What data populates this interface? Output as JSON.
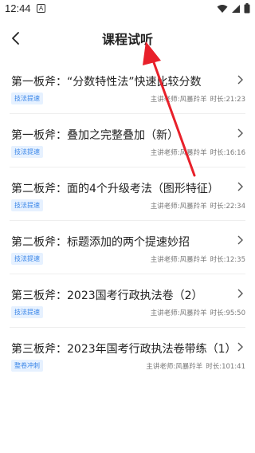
{
  "status_bar": {
    "time": "12:44",
    "notification_glyph": "A",
    "icons": [
      "wifi-icon",
      "signal-icon",
      "battery-icon"
    ]
  },
  "header": {
    "title": "课程试听",
    "back_icon": "chevron-left-icon"
  },
  "courses": [
    {
      "title": "第一板斧：“分数特性法”快速比较分数",
      "tag": "技法提速",
      "teacher": "主讲老师:风暴羚羊",
      "duration": "时长:21:23"
    },
    {
      "title": "第一板斧：叠加之完整叠加（新）",
      "tag": "技法提速",
      "teacher": "主讲老师:风暴羚羊",
      "duration": "时长:16:16"
    },
    {
      "title": "第二板斧：面的4个升级考法（图形特征）",
      "tag": "技法提速",
      "teacher": "主讲老师:风暴羚羊",
      "duration": "时长:22:34"
    },
    {
      "title": "第二板斧：标题添加的两个提速妙招",
      "tag": "技法提速",
      "teacher": "主讲老师:风暴羚羊",
      "duration": "时长:12:35"
    },
    {
      "title": "第三板斧：2023国考行政执法卷（2）",
      "tag": "技法提速",
      "teacher": "主讲老师:风暴羚羊",
      "duration": "时长:95:50"
    },
    {
      "title": "第三板斧：2023年国考行政执法卷带练（1）",
      "tag": "整卷冲刺",
      "teacher": "主讲老师:风暴羚羊",
      "duration": "时长:101:41"
    }
  ],
  "colors": {
    "tag_bg": "#e6f1ff",
    "tag_text": "#3a86e8",
    "annotation_arrow": "#e8202a"
  }
}
